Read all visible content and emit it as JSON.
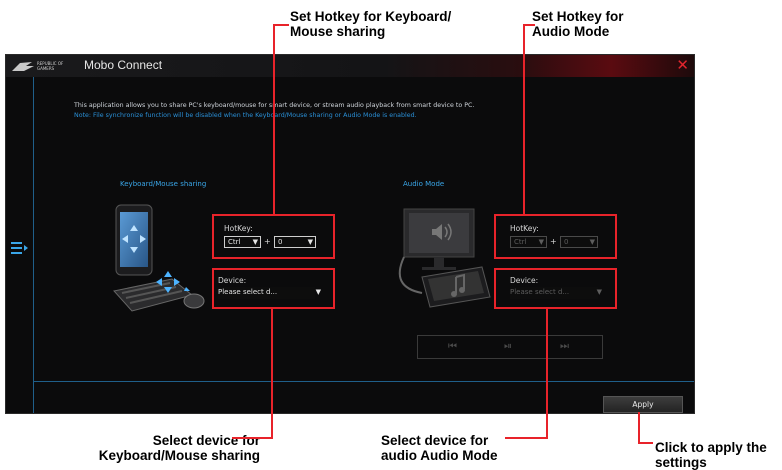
{
  "window": {
    "title": "Mobo Connect",
    "logo_text": "REPUBLIC OF GAMERS",
    "close_glyph": "✕"
  },
  "main": {
    "description": "This application allows you to share PC's keyboard/mouse for smart device, or stream audio playback from smart device to PC.",
    "note": "Note: File synchronize function will be disabled when the Keyboard/Mouse sharing or Audio Mode is enabled."
  },
  "keyboard_section": {
    "title": "Keyboard/Mouse sharing",
    "hotkey_label": "HotKey:",
    "hotkey_modifier": "Ctrl",
    "plus": "+",
    "hotkey_key": "0",
    "device_label": "Device:",
    "device_value": "Please select d..."
  },
  "audio_section": {
    "title": "Audio Mode",
    "hotkey_label": "HotKey:",
    "hotkey_modifier": "Ctrl",
    "plus": "+",
    "hotkey_key": "0",
    "device_label": "Device:",
    "device_value": "Please select d...",
    "controls": {
      "prev": "⏮",
      "play_pause": "⏯",
      "next": "⏭"
    }
  },
  "footer": {
    "apply_label": "Apply"
  },
  "callouts": {
    "kb_hotkey": "Set Hotkey for Keyboard/\nMouse sharing",
    "audio_hotkey": "Set Hotkey for\nAudio Mode",
    "kb_device": "Select device for\nKeyboard/Mouse sharing",
    "audio_device": "Select device for\naudio Audio Mode",
    "apply": "Click to apply the\nsettings"
  },
  "colors": {
    "accent_red": "#e8232a",
    "accent_blue": "#3aa6e8",
    "note_blue": "#2a8fd6",
    "background": "#0b0b0c"
  }
}
